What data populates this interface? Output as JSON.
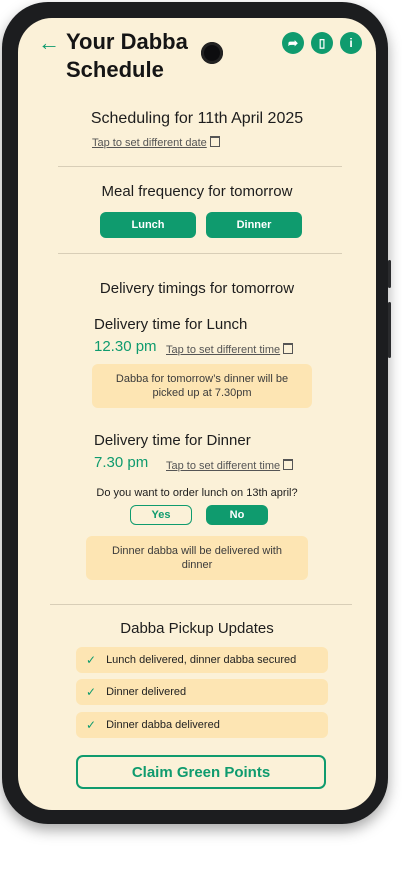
{
  "header": {
    "title": "Your Dabba Schedule",
    "back_icon": "←",
    "icons": [
      "share-icon",
      "bookmark-icon",
      "info-icon"
    ]
  },
  "schedule": {
    "heading": "Scheduling for 11th April 2025",
    "change_date": "Tap to set different date"
  },
  "frequency": {
    "heading": "Meal frequency for tomorrow",
    "lunch": "Lunch",
    "dinner": "Dinner"
  },
  "delivery": {
    "heading": "Delivery timings for tomorrow",
    "lunch_label": "Delivery time for Lunch",
    "lunch_time": "12.30 pm",
    "lunch_change": "Tap to set different time",
    "lunch_note": "Dabba for tomorrow’s dinner will be picked up at 7.30pm",
    "dinner_label": "Delivery time for Dinner",
    "dinner_time": "7.30 pm",
    "dinner_change": "Tap to set different time",
    "question": "Do you want to order lunch on 13th april?",
    "yes": "Yes",
    "no": "No",
    "dinner_note": "Dinner dabba will be delivered with dinner"
  },
  "updates": {
    "heading": "Dabba Pickup Updates",
    "items": [
      "Lunch delivered, dinner dabba secured",
      "Dinner delivered",
      "Dinner dabba delivered"
    ]
  },
  "claim_button": "Claim Green Points",
  "colors": {
    "accent": "#0f9b6e",
    "background": "#fbf1d8",
    "note": "#fde5b3"
  }
}
